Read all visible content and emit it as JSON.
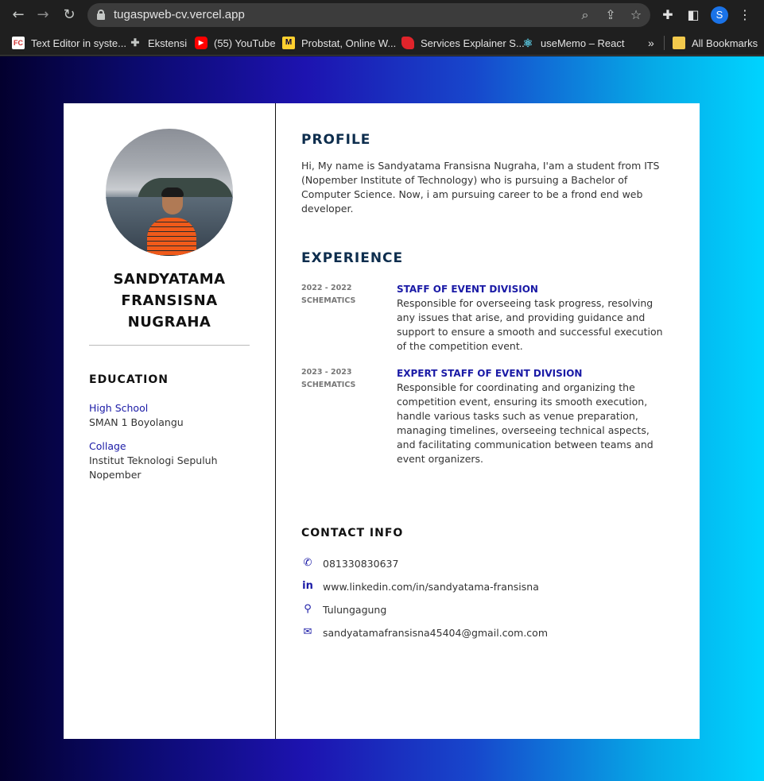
{
  "browser": {
    "url": "tugaspweb-cv.vercel.app",
    "profile_initial": "S",
    "bookmarks": [
      {
        "label": "Text Editor in syste...",
        "icon": "fc-favicon"
      },
      {
        "label": "Ekstensi",
        "icon": "puzzle-icon"
      },
      {
        "label": "(55) YouTube",
        "icon": "youtube-icon"
      },
      {
        "label": "Probstat, Online W...",
        "icon": "miro-icon"
      },
      {
        "label": "Services Explainer S...",
        "icon": "red-favicon"
      },
      {
        "label": "useMemo – React",
        "icon": "react-icon"
      }
    ],
    "all_bookmarks": "All Bookmarks"
  },
  "cv": {
    "name_lines": [
      "SANDYATAMA",
      "FRANSISNA",
      "NUGRAHA"
    ],
    "education": {
      "title": "EDUCATION",
      "items": [
        {
          "label": "High School",
          "value": "SMAN 1 Boyolangu"
        },
        {
          "label": "Collage",
          "value": "Institut Teknologi Sepuluh Nopember"
        }
      ]
    },
    "profile": {
      "title": "PROFILE",
      "text": "Hi, My name is Sandyatama Fransisna Nugraha, I'am a student from ITS (Nopember Institute of Technology) who is pursuing a Bachelor of Computer Science. Now, i am pursuing career to be a frond end web developer."
    },
    "experience": {
      "title": "EXPERIENCE",
      "items": [
        {
          "years": "2022 - 2022",
          "org": "SCHEMATICS",
          "role": "STAFF OF EVENT DIVISION",
          "desc": "Responsible for overseeing task progress, resolving any issues that arise, and providing guidance and support to ensure a smooth and successful execution of the competition event."
        },
        {
          "years": "2023 - 2023",
          "org": "SCHEMATICS",
          "role": "EXPERT STAFF OF EVENT DIVISION",
          "desc": "Responsible for coordinating and organizing the competition event, ensuring its smooth execution, handle various tasks such as venue preparation, managing timelines, overseeing technical aspects, and facilitating communication between teams and event organizers."
        }
      ]
    },
    "contact": {
      "title": "CONTACT INFO",
      "items": [
        {
          "icon": "phone-icon",
          "glyph": "✆",
          "text": "081330830637"
        },
        {
          "icon": "linkedin-icon",
          "glyph": "in",
          "text": "www.linkedin.com/in/sandyatama-fransisna"
        },
        {
          "icon": "map-pin-icon",
          "glyph": "⚲",
          "text": "Tulungagung"
        },
        {
          "icon": "envelope-icon",
          "glyph": "✉",
          "text": "sandyatamafransisna45404@gmail.com.com"
        }
      ]
    }
  }
}
